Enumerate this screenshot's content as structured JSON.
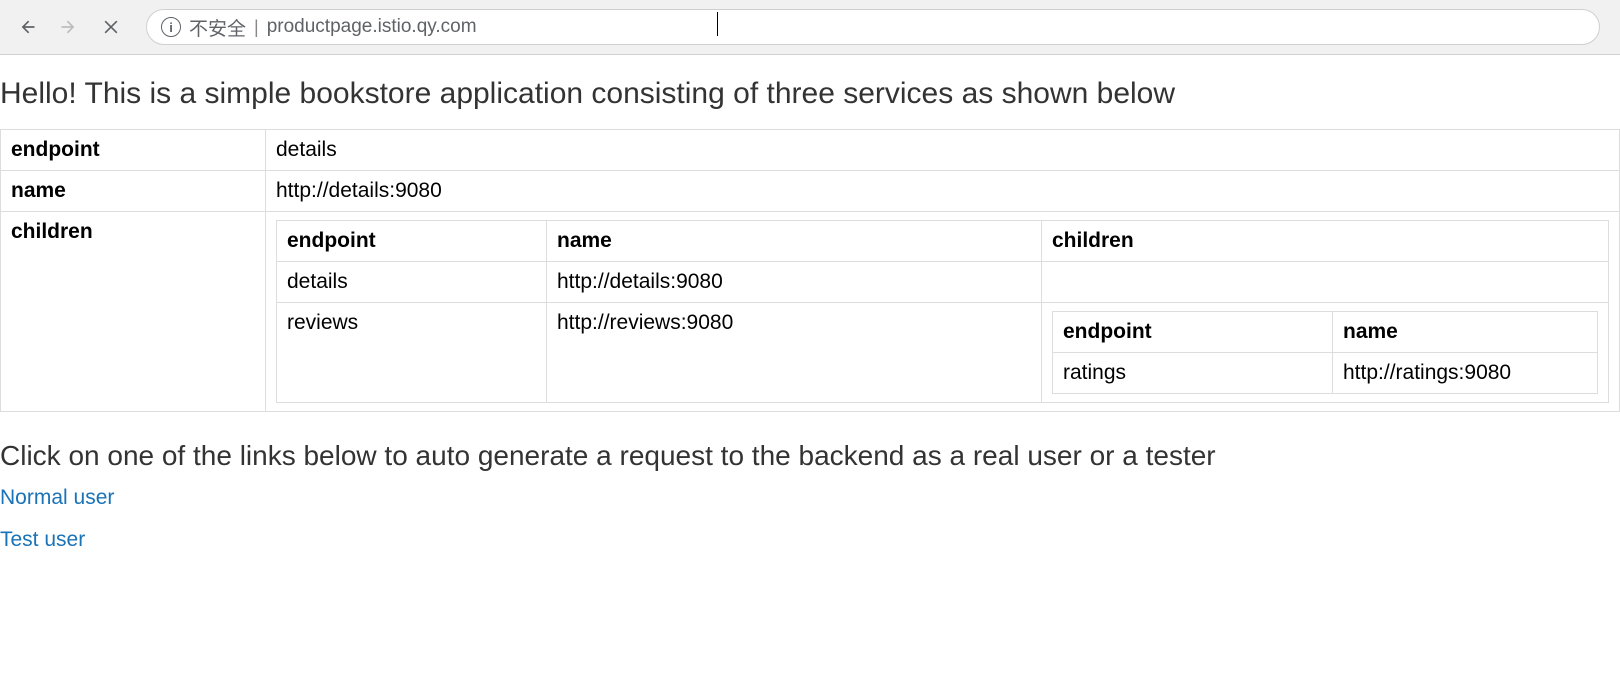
{
  "browser": {
    "insecure_label": "不安全",
    "url": "productpage.istio.qy.com"
  },
  "page": {
    "heading": "Hello! This is a simple bookstore application consisting of three services as shown below",
    "labels": {
      "endpoint": "endpoint",
      "name": "name",
      "children": "children"
    },
    "root": {
      "endpoint": "details",
      "name": "http://details:9080"
    },
    "children": [
      {
        "endpoint": "details",
        "name": "http://details:9080",
        "children_empty": ""
      },
      {
        "endpoint": "reviews",
        "name": "http://reviews:9080",
        "grandchildren": [
          {
            "endpoint": "ratings",
            "name": "http://ratings:9080"
          }
        ]
      }
    ],
    "instruction": "Click on one of the links below to auto generate a request to the backend as a real user or a tester",
    "links": {
      "normal": "Normal user",
      "test": "Test user"
    }
  }
}
